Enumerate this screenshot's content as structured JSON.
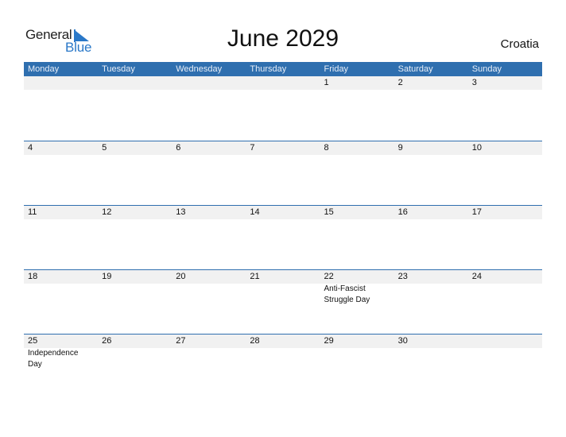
{
  "logo": {
    "general": "General",
    "blue": "Blue",
    "brand_color": "#2a78c8"
  },
  "title": "June 2029",
  "country": "Croatia",
  "header_color": "#2f6faf",
  "weekdays": [
    "Monday",
    "Tuesday",
    "Wednesday",
    "Thursday",
    "Friday",
    "Saturday",
    "Sunday"
  ],
  "weeks": [
    {
      "days": [
        "",
        "",
        "",
        "",
        "1",
        "2",
        "3"
      ],
      "events": [
        "",
        "",
        "",
        "",
        "",
        "",
        ""
      ]
    },
    {
      "days": [
        "4",
        "5",
        "6",
        "7",
        "8",
        "9",
        "10"
      ],
      "events": [
        "",
        "",
        "",
        "",
        "",
        "",
        ""
      ]
    },
    {
      "days": [
        "11",
        "12",
        "13",
        "14",
        "15",
        "16",
        "17"
      ],
      "events": [
        "",
        "",
        "",
        "",
        "",
        "",
        ""
      ]
    },
    {
      "days": [
        "18",
        "19",
        "20",
        "21",
        "22",
        "23",
        "24"
      ],
      "events": [
        "",
        "",
        "",
        "",
        "Anti-Fascist Struggle Day",
        "",
        ""
      ]
    },
    {
      "days": [
        "25",
        "26",
        "27",
        "28",
        "29",
        "30",
        ""
      ],
      "events": [
        "Independence Day",
        "",
        "",
        "",
        "",
        "",
        ""
      ]
    }
  ]
}
